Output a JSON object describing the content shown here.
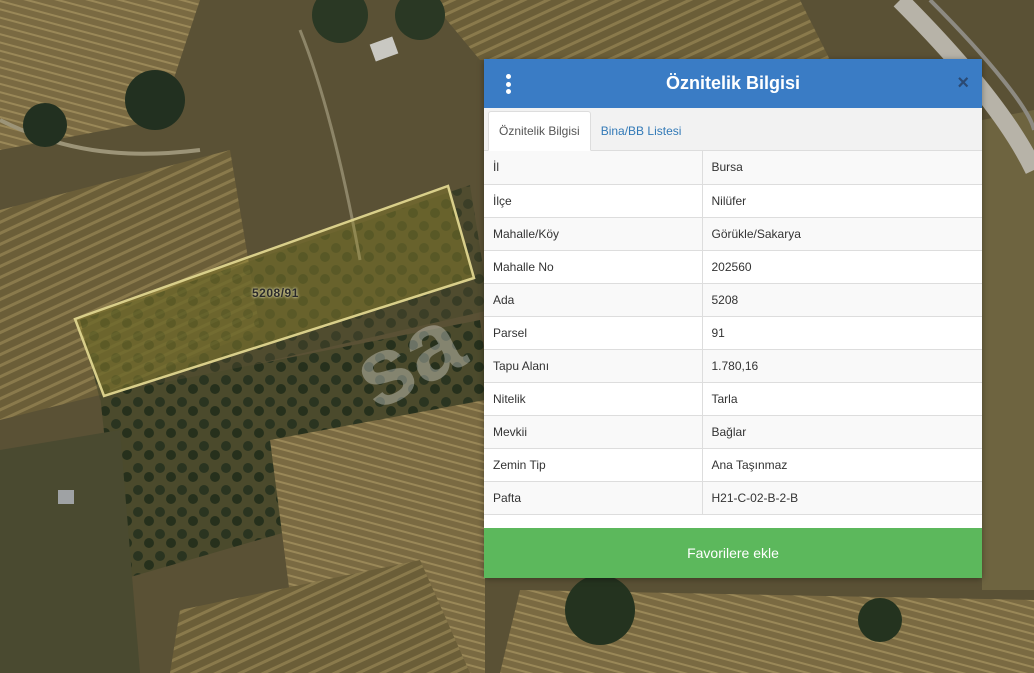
{
  "map": {
    "parcel_label": "5208/91",
    "watermark": "sa",
    "parcel_outline_color": "#d9cf8a"
  },
  "panel": {
    "title": "Öznitelik Bilgisi",
    "close_label": "×",
    "header_color": "#3a7cc5",
    "tabs": [
      {
        "label": "Öznitelik Bilgisi",
        "active": true
      },
      {
        "label": "Bina/BB Listesi",
        "active": false
      }
    ],
    "rows": [
      {
        "key": "İl",
        "value": "Bursa"
      },
      {
        "key": "İlçe",
        "value": "Nilüfer"
      },
      {
        "key": "Mahalle/Köy",
        "value": "Görükle/Sakarya"
      },
      {
        "key": "Mahalle No",
        "value": "202560"
      },
      {
        "key": "Ada",
        "value": "5208"
      },
      {
        "key": "Parsel",
        "value": "91"
      },
      {
        "key": "Tapu Alanı",
        "value": "1.780,16"
      },
      {
        "key": "Nitelik",
        "value": "Tarla"
      },
      {
        "key": "Mevkii",
        "value": "Bağlar"
      },
      {
        "key": "Zemin Tip",
        "value": "Ana Taşınmaz"
      },
      {
        "key": "Pafta",
        "value": "H21-C-02-B-2-B"
      }
    ],
    "favorite_button": "Favorilere ekle",
    "favorite_color": "#5cb85c"
  }
}
